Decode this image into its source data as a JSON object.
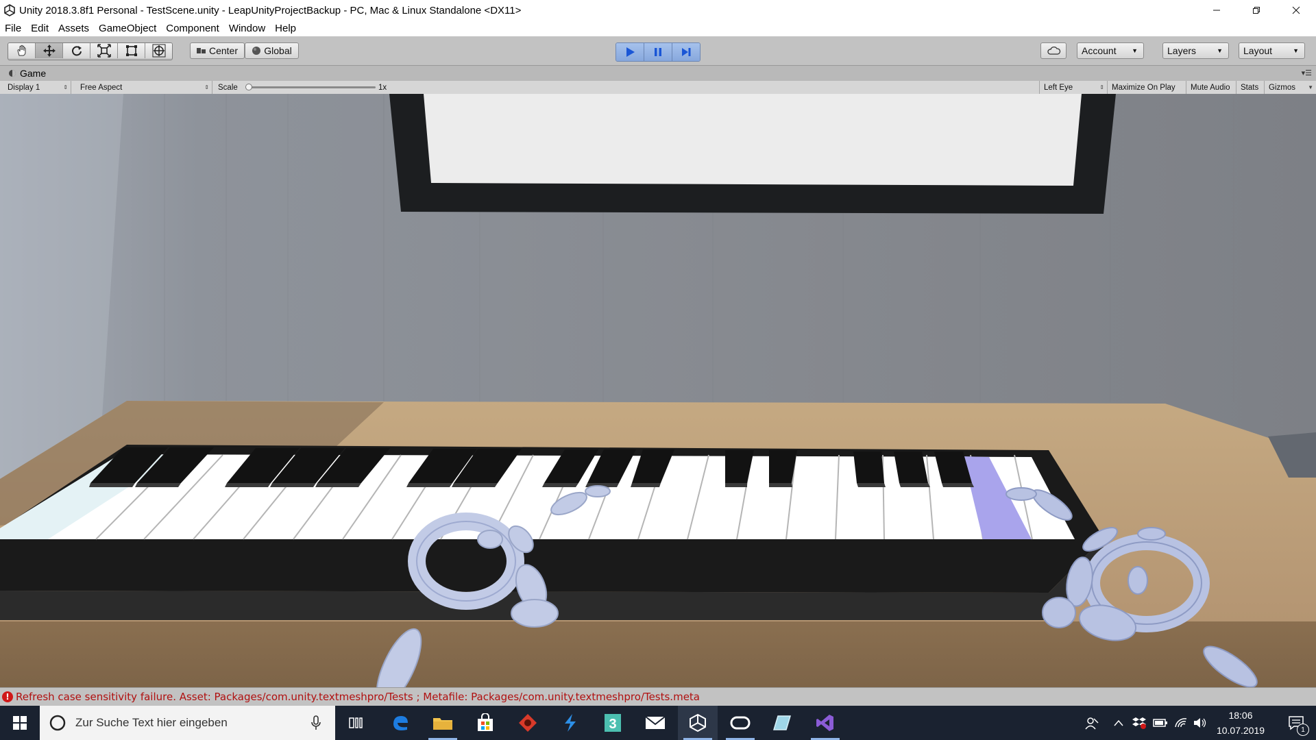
{
  "window": {
    "title": "Unity 2018.3.8f1 Personal - TestScene.unity - LeapUnityProjectBackup - PC, Mac & Linux Standalone <DX11>",
    "icon": "unity-logo-icon",
    "controls": [
      "minimize-icon",
      "maximize-icon",
      "close-icon"
    ]
  },
  "menu": {
    "items": [
      "File",
      "Edit",
      "Assets",
      "GameObject",
      "Component",
      "Window",
      "Help"
    ]
  },
  "toolbar": {
    "tools": [
      "hand-tool-icon",
      "move-tool-icon",
      "rotate-tool-icon",
      "scale-tool-icon",
      "rect-tool-icon",
      "transform-tool-icon"
    ],
    "active_tool": "move-tool-icon",
    "pivot_label": "Center",
    "space_label": "Global",
    "playback": [
      "play-icon",
      "pause-icon",
      "step-icon"
    ],
    "play_active": true,
    "account_label": "Account",
    "layers_label": "Layers",
    "layout_label": "Layout",
    "accent_color": "#3a6fd8"
  },
  "game_view": {
    "tab_label": "Game",
    "display_label": "Display 1",
    "aspect_label": "Free Aspect",
    "scale_label": "Scale",
    "scale_value": "1x",
    "eye_label": "Left Eye",
    "toggles": [
      "Maximize On Play",
      "Mute Audio",
      "Stats",
      "Gizmos"
    ]
  },
  "scene": {
    "highlighted_key_color": "#a9a4ec",
    "hand_color": "#c2cbe6"
  },
  "console": {
    "message": "Refresh case sensitivity failure. Asset: Packages/com.unity.textmeshpro/Tests ; Metafile: Packages/com.unity.textmeshpro/Tests.meta",
    "level_icon": "error-icon"
  },
  "taskbar": {
    "search_placeholder": "Zur Suche Text hier eingeben",
    "apps": [
      "task-view-icon",
      "edge-icon",
      "file-explorer-icon",
      "store-icon",
      "app-red-icon",
      "app-blue-icon",
      "app-3-icon",
      "mail-icon",
      "unity-icon",
      "oculus-icon",
      "app-glass-icon",
      "visual-studio-icon"
    ],
    "time": "18:06",
    "date": "10.07.2019",
    "notification_count": "1"
  }
}
